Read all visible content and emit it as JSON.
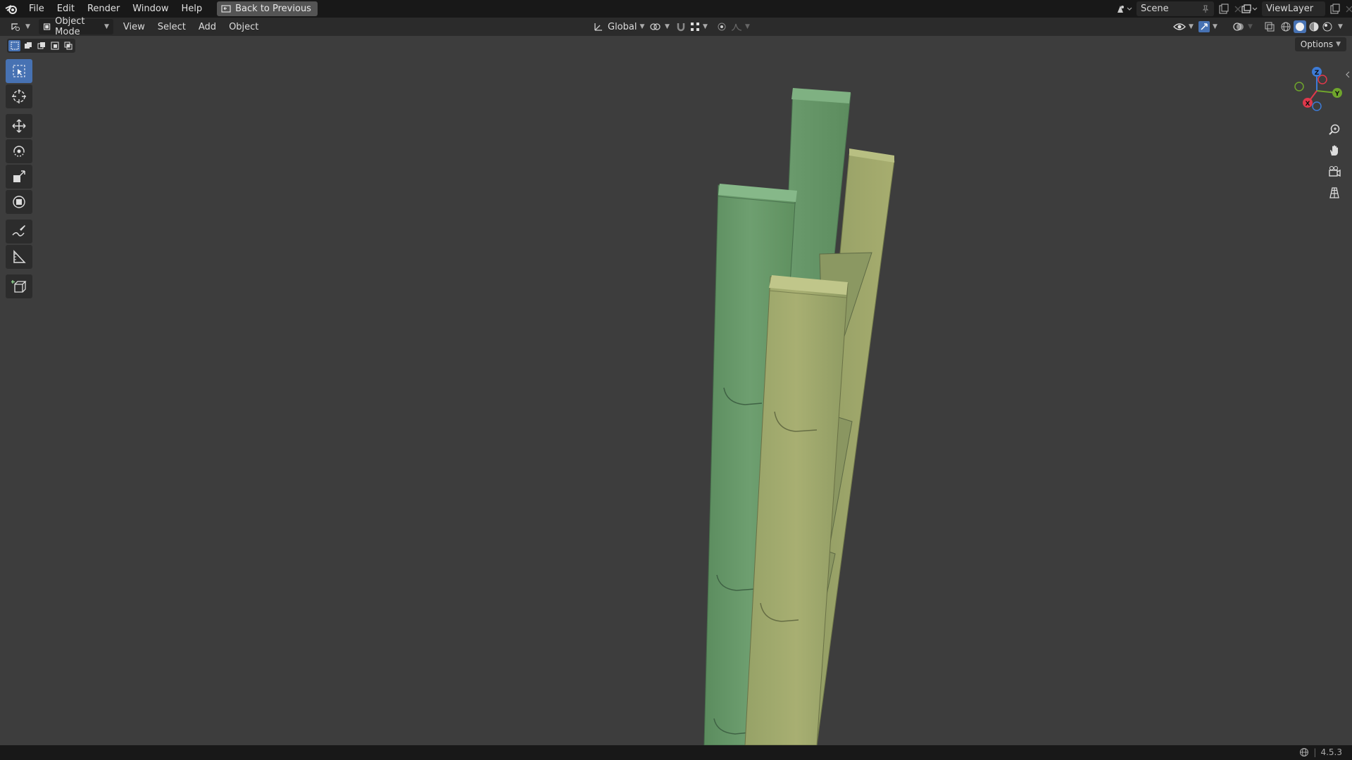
{
  "topbar": {
    "menus": [
      "File",
      "Edit",
      "Render",
      "Window",
      "Help"
    ],
    "back_button": "Back to Previous",
    "scene_name": "Scene",
    "view_layer": "ViewLayer"
  },
  "header": {
    "mode": "Object Mode",
    "menus": [
      "View",
      "Select",
      "Add",
      "Object"
    ],
    "transform_orientation": "Global"
  },
  "viewport": {
    "options_label": "Options",
    "gizmo_axes": [
      "Z",
      "Y",
      "X"
    ],
    "toolbar_tools": [
      "select-box",
      "cursor",
      "move",
      "rotate",
      "scale",
      "transform",
      "annotate",
      "measure",
      "add-cube"
    ],
    "nav_buttons": [
      "zoom",
      "pan",
      "camera",
      "perspective-toggle"
    ]
  },
  "status": {
    "version": "4.5.3"
  },
  "colors": {
    "accent": "#4772b3",
    "object_green": "#6a9b6c",
    "object_olive": "#a2a86c"
  }
}
